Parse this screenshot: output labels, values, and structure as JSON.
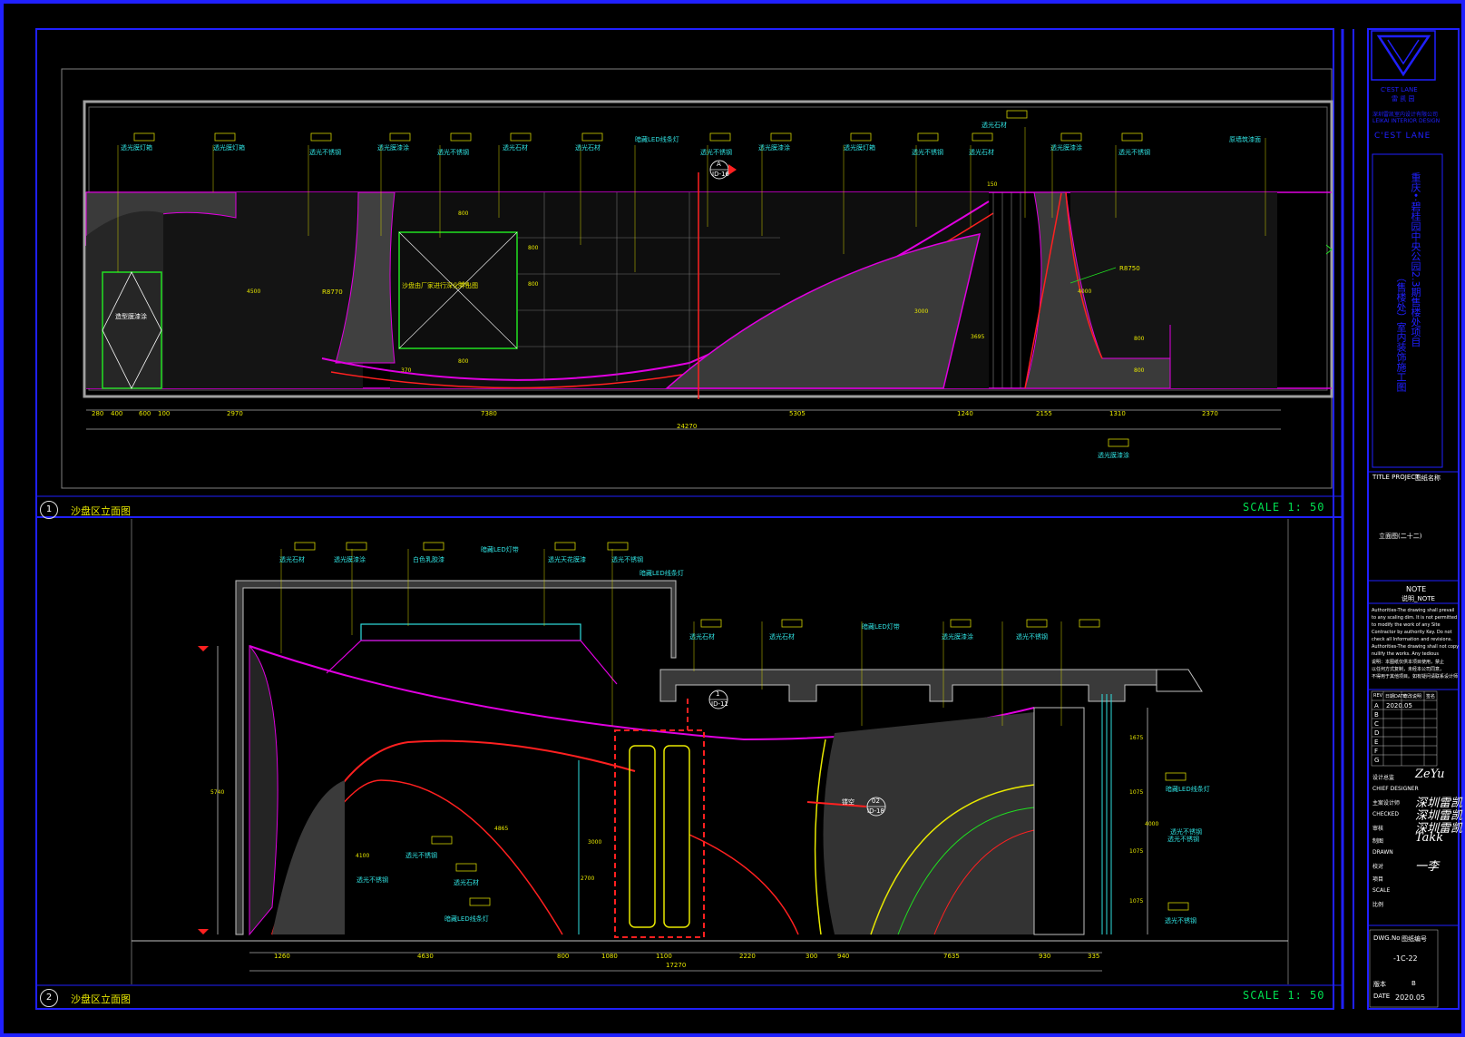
{
  "views": [
    {
      "number": "1",
      "title": "沙盘区立面图",
      "scale": "SCALE 1: 50"
    },
    {
      "number": "2",
      "title": "沙盘区立面图",
      "scale": "SCALE 1: 50"
    }
  ],
  "view1": {
    "labels": [
      "透光膜灯箱",
      "透光膜灯箱",
      "透光不锈钢",
      "透光膜漆涂",
      "透光不锈钢",
      "透光石材",
      "透光石材",
      "暗藏LED线条灯",
      "透光不锈钢",
      "透光膜漆涂",
      "透光膜灯箱",
      "透光不锈钢",
      "透光石材",
      "透光石材",
      "透光膜漆涂",
      "透光不锈钢",
      "原墙筑漆面",
      "透光膜漆涂"
    ],
    "center_note": "沙盘由厂家进行深化并出图",
    "door_note": "造型膜漆涂",
    "radius_left": "R8770",
    "radius_right": "R8750",
    "dim_top": [
      "280",
      "400",
      "600",
      "100",
      "2970",
      "7380",
      "5305",
      "1240",
      "2155",
      "1310",
      "2370"
    ],
    "dim_total": "24270",
    "dims_vertical": [
      "4500",
      "800",
      "800",
      "800",
      "800",
      "800",
      "370",
      "150",
      "4000",
      "800",
      "800",
      "3000",
      "3695"
    ],
    "section_tag": {
      "top": "A",
      "bottom": "ID-16"
    }
  },
  "view2": {
    "labels": [
      "透光石材",
      "透光膜漆涂",
      "白色乳胶漆",
      "暗藏LED灯带",
      "透光天花膜漆",
      "透光不锈钢",
      "暗藏LED线条灯",
      "透光石材",
      "透光石材",
      "暗藏LED灯带",
      "透光膜漆涂",
      "透光不锈钢",
      "透光不锈钢",
      "透光石材",
      "暗藏LED线条灯",
      "透光不锈钢",
      "暗藏LED线条灯",
      "透光不锈钢",
      "透光不锈钢",
      "透光不锈钢"
    ],
    "dim_bottom": [
      "1260",
      "4630",
      "800",
      "1080",
      "1100",
      "2220",
      "300",
      "940",
      "7635",
      "930",
      "335"
    ],
    "dim_total": "17270",
    "dims_vertical": [
      "5740",
      "4100",
      "4865",
      "3000",
      "2700",
      "1675",
      "1075",
      "4000",
      "1075",
      "1075"
    ],
    "section_tag_a": {
      "top": "1",
      "bottom": "ID-11"
    },
    "section_tag_b": {
      "top": "02",
      "bottom": "ID-18"
    },
    "note_small": "镂空"
  },
  "title_block": {
    "logo_text": "C'EST LANE",
    "logo_sub": "雷 凯 园",
    "company_lines": [
      "深圳雷凯室内设计有限公司",
      "LEIKAI INTERIOR DESIGN"
    ],
    "company_en": "C'EST LANE",
    "project_title_line1": "重庆•·碧桂园中央公园2.3期售楼处项目",
    "project_title_line2": "（售楼处）室内装饰施工图",
    "title_project_label": "TITLE PROJECT",
    "title_project_value": "图纸名称",
    "drawing_name": "立面图(二十二)",
    "note_heading": "NOTE",
    "note_sub": "说明_NOTE",
    "note_lines": [
      "Authorities-The drawing shall prevail",
      "to any scaling dim. It is not permitted",
      "to modify the work of any  Site",
      "Contractor by authority Key. Do not",
      "check all  Information and revisions.",
      "Authorities-The drawing shall not copy",
      "nullify the works. Any tedious",
      "说明：本图纸仅供本项目使用，禁止",
      "以任何方式复制，未经本公司同意，",
      "不得用于其他项目。如有疑问请联系设计师"
    ],
    "rev_header": [
      "REV",
      "日期DATE",
      "修改说明",
      "签名"
    ],
    "rev_rows": [
      "A",
      "B",
      "C",
      "D",
      "E",
      "F",
      "G"
    ],
    "rev_a_date": "2020.05",
    "sig_rows": [
      {
        "label": "设计总监",
        "sig": "ZeYu"
      },
      {
        "label": "CHIEF DESIGNER",
        "sig": ""
      },
      {
        "label": "主案设计师",
        "sig": "深圳雷凯"
      },
      {
        "label": "CHECKED",
        "sig": "深圳雷凯"
      },
      {
        "label": "审核",
        "sig": "深圳雷凯"
      },
      {
        "label": "制图",
        "sig": "Takk"
      },
      {
        "label": "DRAWN",
        "sig": ""
      },
      {
        "label": "校对",
        "sig": "一李"
      },
      {
        "label": "项目",
        "sig": ""
      },
      {
        "label": "SCALE",
        "sig": ""
      },
      {
        "label": "比例",
        "sig": ""
      }
    ],
    "dwg_no_label": "DWG.No",
    "dwg_no_value": "图纸编号",
    "dwg_no": "-1C-22",
    "date_label": "DATE",
    "date_value": "2020.05",
    "issue_label": "版本",
    "issue_value": "B"
  }
}
